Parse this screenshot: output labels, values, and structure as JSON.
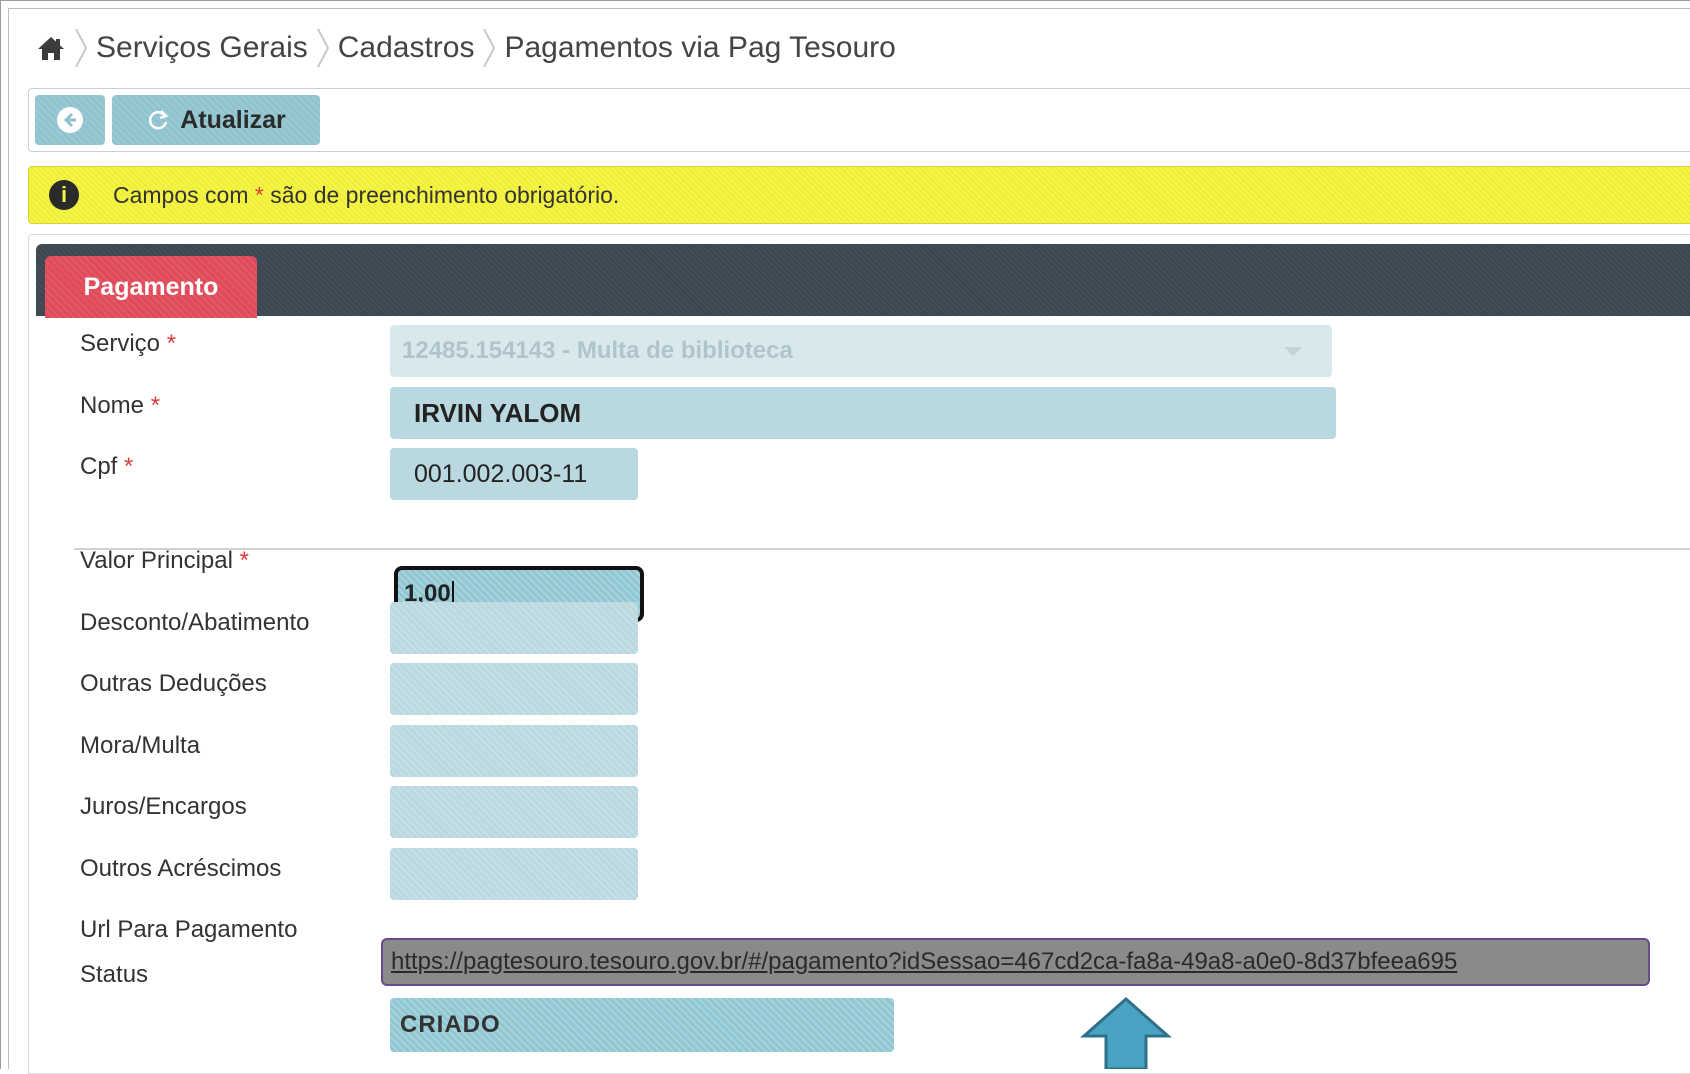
{
  "breadcrumb": {
    "items": [
      "Serviços Gerais",
      "Cadastros",
      "Pagamentos via Pag Tesouro"
    ]
  },
  "toolbar": {
    "refresh_label": "Atualizar"
  },
  "alert": {
    "text_before": "Campos com ",
    "required_mark": "*",
    "text_after": " são de preenchimento obrigatório."
  },
  "tabs": [
    {
      "label": "Pagamento",
      "active": true
    }
  ],
  "form": {
    "servico": {
      "label": "Serviço",
      "value": "12485.154143 - Multa de biblioteca"
    },
    "nome": {
      "label": "Nome",
      "value": "IRVIN YALOM"
    },
    "cpf": {
      "label": "Cpf",
      "value": "001.002.003-11"
    },
    "valor_principal": {
      "label": "Valor Principal",
      "value": "1,00"
    },
    "desconto": {
      "label": "Desconto/Abatimento",
      "value": ""
    },
    "outras_deducoes": {
      "label": "Outras Deduções",
      "value": ""
    },
    "mora_multa": {
      "label": "Mora/Multa",
      "value": ""
    },
    "juros": {
      "label": "Juros/Encargos",
      "value": ""
    },
    "outros_acrescimos": {
      "label": "Outros Acréscimos",
      "value": ""
    },
    "url_pagamento": {
      "label": "Url Para Pagamento",
      "value": "https://pagtesouro.tesouro.gov.br/#/pagamento?idSessao=467cd2ca-fa8a-49a8-a0e0-8d37bfeea695"
    },
    "status": {
      "label": "Status",
      "value": "CRIADO"
    },
    "required_mark": "*"
  },
  "colors": {
    "accent_tab": "#e04b5a",
    "tabbar": "#3a4650",
    "input_bg": "#b9d8df",
    "alert_bg": "#f5f542",
    "arrow": "#4aa3c3"
  }
}
